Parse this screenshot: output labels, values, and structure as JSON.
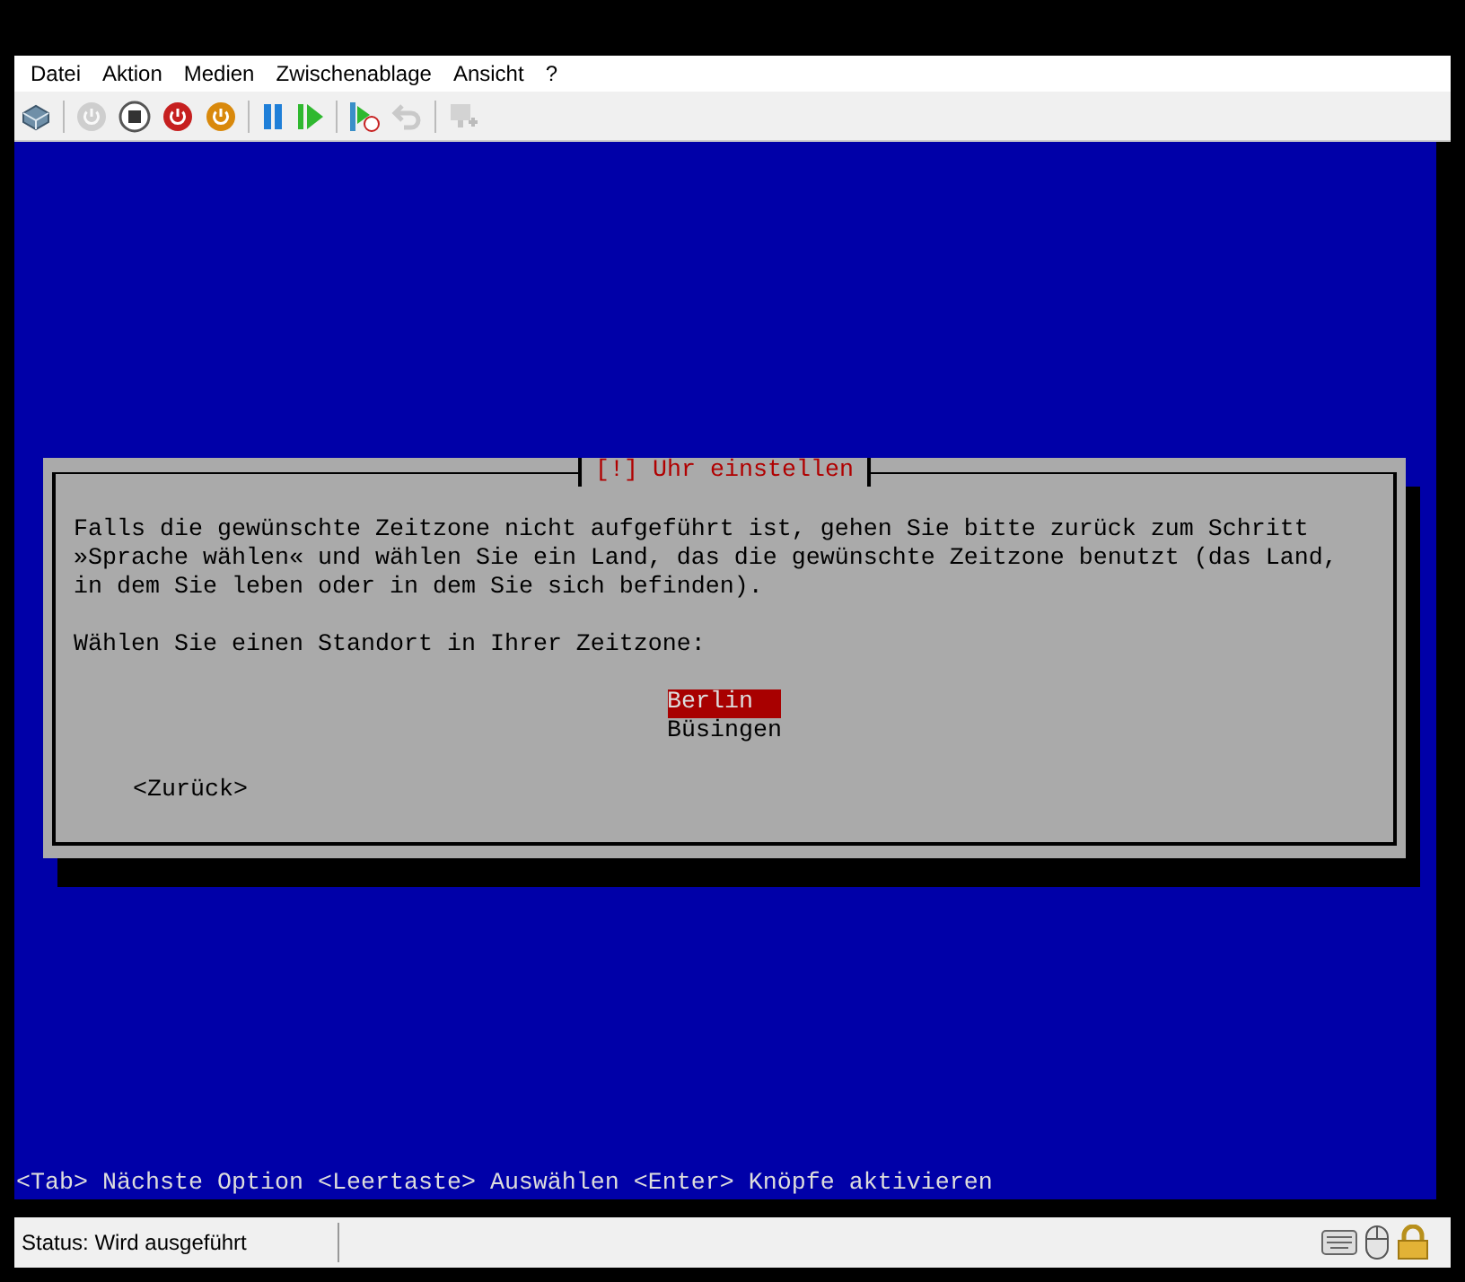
{
  "menu": [
    {
      "label": "Datei"
    },
    {
      "label": "Aktion"
    },
    {
      "label": "Medien"
    },
    {
      "label": "Zwischenablage"
    },
    {
      "label": "Ansicht"
    },
    {
      "label": "?"
    }
  ],
  "toolbar": [
    {
      "kind": "ctrl-alt-del",
      "disabled": false
    },
    {
      "kind": "sep"
    },
    {
      "kind": "start",
      "disabled": true
    },
    {
      "kind": "stop",
      "disabled": false
    },
    {
      "kind": "shutdown",
      "disabled": false
    },
    {
      "kind": "save",
      "disabled": false
    },
    {
      "kind": "sep"
    },
    {
      "kind": "pause",
      "disabled": false
    },
    {
      "kind": "reset",
      "disabled": false
    },
    {
      "kind": "sep"
    },
    {
      "kind": "checkpoint",
      "disabled": false
    },
    {
      "kind": "revert",
      "disabled": true
    },
    {
      "kind": "sep"
    },
    {
      "kind": "enhanced",
      "disabled": true
    }
  ],
  "dialog": {
    "title": "[!] Uhr einstellen",
    "message": "Falls die gewünschte Zeitzone nicht aufgeführt ist, gehen Sie bitte zurück zum Schritt\n»Sprache wählen« und wählen Sie ein Land, das die gewünschte Zeitzone benutzt (das Land,\nin dem Sie leben oder in dem Sie sich befinden).",
    "prompt": "Wählen Sie einen Standort in Ihrer Zeitzone:",
    "options": [
      {
        "label": "Berlin ",
        "selected": true
      },
      {
        "label": "Büsingen",
        "selected": false
      }
    ],
    "back_button": "<Zurück>"
  },
  "hint_line": "<Tab> Nächste Option <Leertaste> Auswählen <Enter> Knöpfe aktivieren",
  "status_bar": {
    "status": "Status: Wird ausgeführt"
  }
}
